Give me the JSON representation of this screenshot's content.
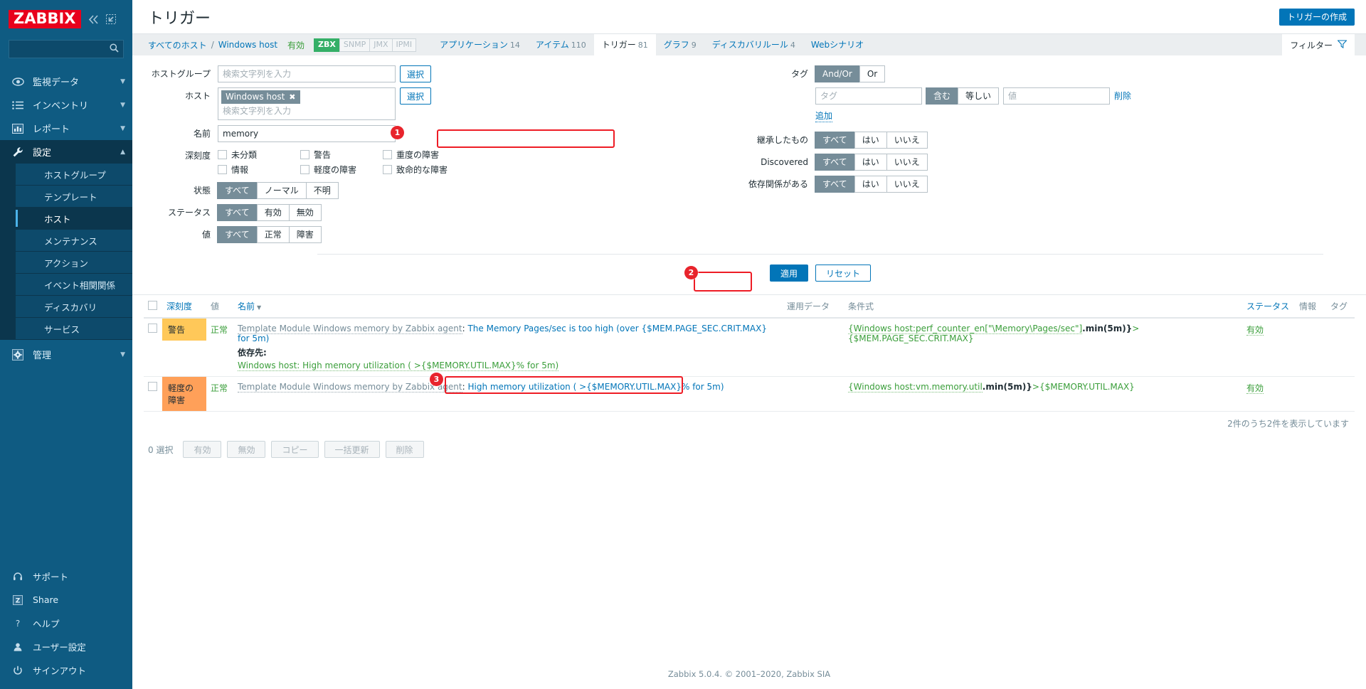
{
  "brand": {
    "name": "ZABBIX",
    "accent": "#e8001c",
    "sidebar_bg": "#0f5b82"
  },
  "sidebar": {
    "search_placeholder": "",
    "menu": [
      {
        "label": "監視データ",
        "icon": "eye-icon",
        "has_chevron": true,
        "selected": false
      },
      {
        "label": "インベントリ",
        "icon": "list-icon",
        "has_chevron": true,
        "selected": false
      },
      {
        "label": "レポート",
        "icon": "chart-bar-icon",
        "has_chevron": true,
        "selected": false
      },
      {
        "label": "設定",
        "icon": "wrench-icon",
        "has_chevron": true,
        "selected": true
      }
    ],
    "submenu": [
      {
        "label": "ホストグループ",
        "active": false
      },
      {
        "label": "テンプレート",
        "active": false
      },
      {
        "label": "ホスト",
        "active": true
      },
      {
        "label": "メンテナンス",
        "active": false
      },
      {
        "label": "アクション",
        "active": false
      },
      {
        "label": "イベント相関関係",
        "active": false
      },
      {
        "label": "ディスカバリ",
        "active": false
      },
      {
        "label": "サービス",
        "active": false
      }
    ],
    "menu_after": [
      {
        "label": "管理",
        "icon": "gear-icon",
        "has_chevron": true,
        "selected": false
      }
    ],
    "bottom": [
      {
        "label": "サポート",
        "icon": "headset-icon"
      },
      {
        "label": "Share",
        "icon": "zabbix-share-icon"
      },
      {
        "label": "ヘルプ",
        "icon": "question-icon"
      },
      {
        "label": "ユーザー設定",
        "icon": "user-icon"
      },
      {
        "label": "サインアウト",
        "icon": "power-icon"
      }
    ]
  },
  "header": {
    "title": "トリガー",
    "create_button": "トリガーの作成"
  },
  "breadcrumb": {
    "all_hosts": "すべてのホスト",
    "separator": "/",
    "host": "Windows host",
    "status": "有効",
    "protocols": [
      {
        "label": "ZBX",
        "enabled": true
      },
      {
        "label": "SNMP",
        "enabled": false
      },
      {
        "label": "JMX",
        "enabled": false
      },
      {
        "label": "IPMI",
        "enabled": false
      }
    ],
    "tabs": [
      {
        "label": "アプリケーション",
        "count": "14",
        "active": false
      },
      {
        "label": "アイテム",
        "count": "110",
        "active": false
      },
      {
        "label": "トリガー",
        "count": "81",
        "active": true
      },
      {
        "label": "グラフ",
        "count": "9",
        "active": false
      },
      {
        "label": "ディスカバリルール",
        "count": "4",
        "active": false
      },
      {
        "label": "Webシナリオ",
        "count": "",
        "active": false
      }
    ],
    "filter_toggle": "フィルター"
  },
  "filter": {
    "host_group": {
      "label": "ホストグループ",
      "placeholder": "検索文字列を入力",
      "value": "",
      "select_button": "選択"
    },
    "host": {
      "label": "ホスト",
      "chip": "Windows host",
      "placeholder": "検索文字列を入力",
      "select_button": "選択"
    },
    "name": {
      "label": "名前",
      "value": "memory"
    },
    "severity": {
      "label": "深刻度",
      "options": [
        {
          "label": "未分類",
          "checked": false
        },
        {
          "label": "警告",
          "checked": false
        },
        {
          "label": "重度の障害",
          "checked": false
        },
        {
          "label": "情報",
          "checked": false
        },
        {
          "label": "軽度の障害",
          "checked": false
        },
        {
          "label": "致命的な障害",
          "checked": false
        }
      ]
    },
    "state": {
      "label": "状態",
      "options": [
        "すべて",
        "ノーマル",
        "不明"
      ],
      "selected": "すべて"
    },
    "status": {
      "label": "ステータス",
      "options": [
        "すべて",
        "有効",
        "無効"
      ],
      "selected": "すべて"
    },
    "value": {
      "label": "値",
      "options": [
        "すべて",
        "正常",
        "障害"
      ],
      "selected": "すべて"
    },
    "tags": {
      "label": "タグ",
      "evaltype": {
        "options": [
          "And/Or",
          "Or"
        ],
        "selected": "And/Or"
      },
      "tag_placeholder": "タグ",
      "tag_value": "",
      "operator": {
        "options": [
          "含む",
          "等しい"
        ],
        "selected": "含む"
      },
      "value_placeholder": "値",
      "value_value": "",
      "remove_label": "削除",
      "add_label": "追加"
    },
    "inherited": {
      "label": "継承したもの",
      "options": [
        "すべて",
        "はい",
        "いいえ"
      ],
      "selected": "すべて"
    },
    "discovered": {
      "label": "Discovered",
      "options": [
        "すべて",
        "はい",
        "いいえ"
      ],
      "selected": "すべて"
    },
    "dependency": {
      "label": "依存関係がある",
      "options": [
        "すべて",
        "はい",
        "いいえ"
      ],
      "selected": "すべて"
    },
    "apply_button": "適用",
    "reset_button": "リセット"
  },
  "table": {
    "headers": {
      "severity": "深刻度",
      "value": "値",
      "name": "名前",
      "op_data": "運用データ",
      "expression": "条件式",
      "status": "ステータス",
      "info": "情報",
      "tags": "タグ"
    },
    "sort_indicator": "▼",
    "rows": [
      {
        "severity": "警告",
        "severity_class": "warning",
        "value": "正常",
        "template_prefix": "Template Module Windows memory by Zabbix agent",
        "name": "The Memory Pages/sec is too high (over {$MEM.PAGE_SEC.CRIT.MAX} for 5m)",
        "dependency_title": "依存先:",
        "dependency": "Windows host: High memory utilization ( >{$MEMORY.UTIL.MAX}% for 5m)",
        "op_data": "",
        "expression_ref": "{Windows host:perf_counter_en[\"\\Memory\\Pages/sec\"]",
        "expression_fn": ".min(5m)}",
        "expression_tail": ">{$MEM.PAGE_SEC.CRIT.MAX}",
        "status": "有効",
        "info": "",
        "tags": ""
      },
      {
        "severity": "軽度の障害",
        "severity_class": "average",
        "value": "正常",
        "template_prefix": "Template Module Windows memory by Zabbix agent",
        "name": "High memory utilization ( >{$MEMORY.UTIL.MAX}% for 5m)",
        "dependency_title": "",
        "dependency": "",
        "op_data": "",
        "expression_ref": "{Windows host:vm.memory.util",
        "expression_fn": ".min(5m)}",
        "expression_tail": ">{$MEMORY.UTIL.MAX}",
        "status": "有効",
        "info": "",
        "tags": ""
      }
    ],
    "row_count_text": "2件のうち2件を表示しています"
  },
  "footer_actions": {
    "selected_text": "0 選択",
    "buttons": [
      "有効",
      "無効",
      "コピー",
      "一括更新",
      "削除"
    ]
  },
  "page_footer": "Zabbix 5.0.4. © 2001–2020, Zabbix SIA",
  "annotations": [
    {
      "number": "1",
      "target": "name-filter-field"
    },
    {
      "number": "2",
      "target": "apply-button"
    },
    {
      "number": "3",
      "target": "trigger-name-link"
    }
  ]
}
